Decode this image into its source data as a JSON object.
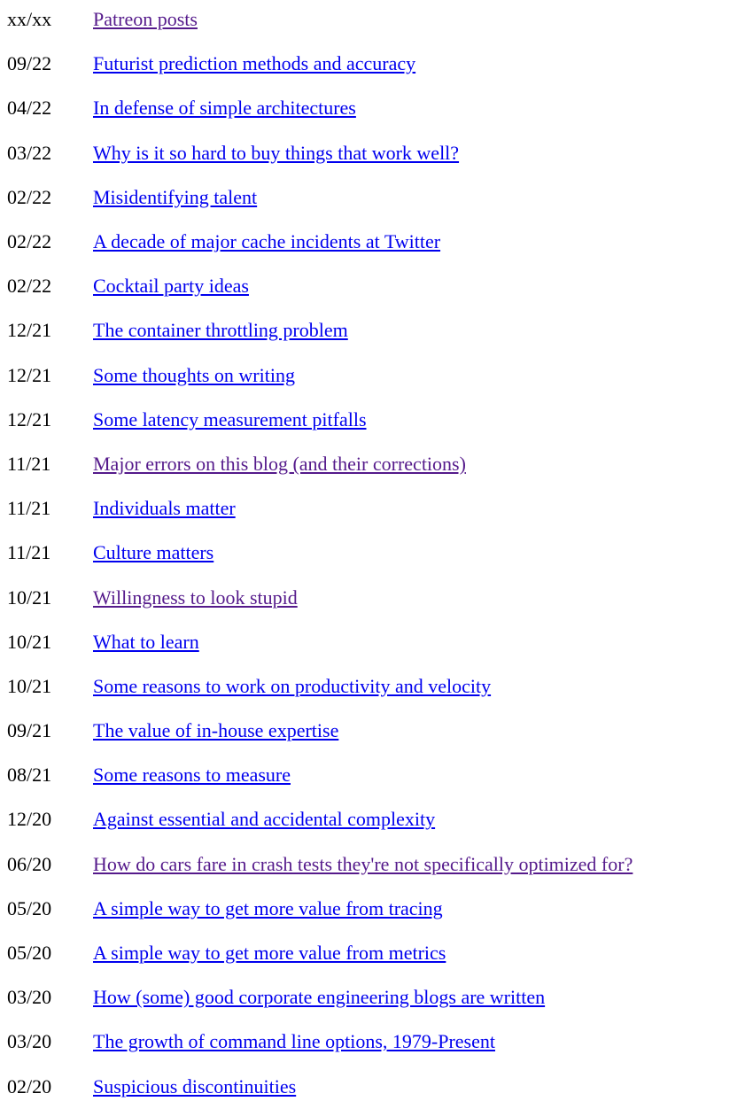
{
  "colors": {
    "link": "#0000EE",
    "visited": "#551A8B",
    "text": "#000000"
  },
  "posts": [
    {
      "date": "xx/xx",
      "title": "Patreon posts",
      "visited": true
    },
    {
      "date": "09/22",
      "title": "Futurist prediction methods and accuracy",
      "visited": false
    },
    {
      "date": "04/22",
      "title": "In defense of simple architectures",
      "visited": false
    },
    {
      "date": "03/22",
      "title": "Why is it so hard to buy things that work well?",
      "visited": false
    },
    {
      "date": "02/22",
      "title": "Misidentifying talent",
      "visited": false
    },
    {
      "date": "02/22",
      "title": "A decade of major cache incidents at Twitter",
      "visited": false
    },
    {
      "date": "02/22",
      "title": "Cocktail party ideas",
      "visited": false
    },
    {
      "date": "12/21",
      "title": "The container throttling problem",
      "visited": false
    },
    {
      "date": "12/21",
      "title": "Some thoughts on writing",
      "visited": false
    },
    {
      "date": "12/21",
      "title": "Some latency measurement pitfalls",
      "visited": false
    },
    {
      "date": "11/21",
      "title": "Major errors on this blog (and their corrections)",
      "visited": true
    },
    {
      "date": "11/21",
      "title": "Individuals matter",
      "visited": false
    },
    {
      "date": "11/21",
      "title": "Culture matters",
      "visited": false
    },
    {
      "date": "10/21",
      "title": "Willingness to look stupid",
      "visited": true
    },
    {
      "date": "10/21",
      "title": "What to learn",
      "visited": false
    },
    {
      "date": "10/21",
      "title": "Some reasons to work on productivity and velocity",
      "visited": false
    },
    {
      "date": "09/21",
      "title": "The value of in-house expertise",
      "visited": false
    },
    {
      "date": "08/21",
      "title": "Some reasons to measure",
      "visited": false
    },
    {
      "date": "12/20",
      "title": "Against essential and accidental complexity",
      "visited": false
    },
    {
      "date": "06/20",
      "title": "How do cars fare in crash tests they're not specifically optimized for?",
      "visited": true
    },
    {
      "date": "05/20",
      "title": "A simple way to get more value from tracing",
      "visited": false
    },
    {
      "date": "05/20",
      "title": "A simple way to get more value from metrics",
      "visited": false
    },
    {
      "date": "03/20",
      "title": "How (some) good corporate engineering blogs are written",
      "visited": false
    },
    {
      "date": "03/20",
      "title": "The growth of command line options, 1979-Present",
      "visited": false
    },
    {
      "date": "02/20",
      "title": "Suspicious discontinuities",
      "visited": false
    }
  ]
}
